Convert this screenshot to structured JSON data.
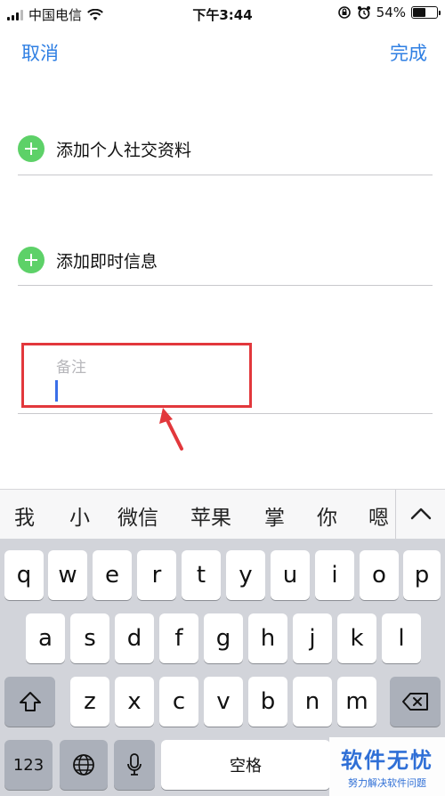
{
  "status_bar": {
    "carrier": "中国电信",
    "time": "下午3:44",
    "battery": "54%",
    "battery_level": 0.54
  },
  "nav": {
    "cancel": "取消",
    "done": "完成"
  },
  "rows": [
    {
      "label": "添加个人社交资料"
    },
    {
      "label": "添加即时信息"
    }
  ],
  "note": {
    "placeholder": "备注"
  },
  "candidates": [
    "我",
    "小",
    "微信",
    "苹果",
    "掌",
    "你",
    "嗯"
  ],
  "keyboard": {
    "row1": [
      "q",
      "w",
      "e",
      "r",
      "t",
      "y",
      "u",
      "i",
      "o",
      "p"
    ],
    "row2": [
      "a",
      "s",
      "d",
      "f",
      "g",
      "h",
      "j",
      "k",
      "l"
    ],
    "row3": [
      "z",
      "x",
      "c",
      "v",
      "b",
      "n",
      "m"
    ],
    "num_key": "123",
    "space": "空格"
  },
  "watermark": {
    "main": "软件无忧",
    "sub": "努力解决软件问题"
  },
  "colors": {
    "accent": "#2f7fe3",
    "plus_green": "#5dd168",
    "highlight_red": "#e2383c",
    "cursor_blue": "#3a6fe8"
  }
}
